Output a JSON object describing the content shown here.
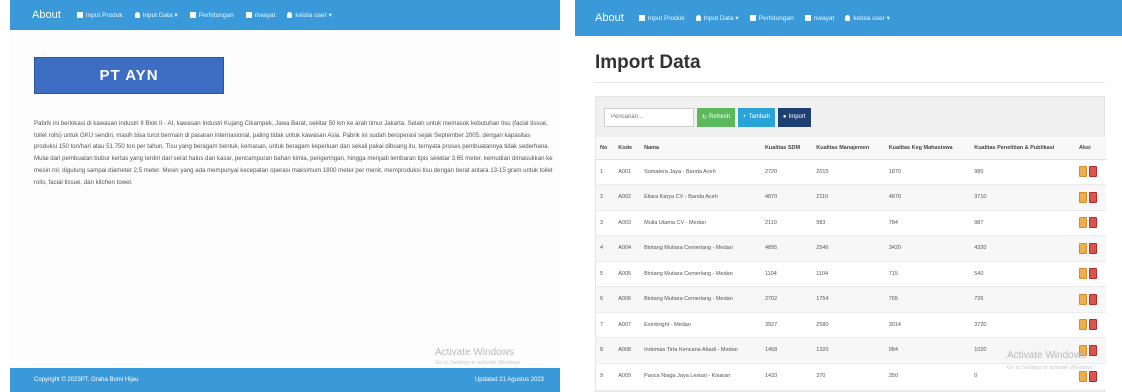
{
  "left": {
    "nav": {
      "brand": "About",
      "items": [
        {
          "label": "Input Produk",
          "icon": "list-icon"
        },
        {
          "label": "Input Data ▾",
          "icon": "user-icon"
        },
        {
          "label": "Perhitungan",
          "icon": "calculator-icon"
        },
        {
          "label": "riwayat",
          "icon": "list-icon"
        },
        {
          "label": "kelola user ▾",
          "icon": "user-icon"
        }
      ]
    },
    "company_name": "PT AYN",
    "description": "Pabrik ini berlokasi di kawasan industri II Blok II - AI, kawasan Industri Kujang Cikampek, Jawa Barat, sekitar 50 km ke arah timur Jakarta. Selain untuk memasok kebutuhan tisu (facial tissue, toilet rolls) untuk GKU sendiri, masih bisa turut bermain di pasaran internasional, paling tidak untuk kawasan Asia. Pabrik ini sudah beroperasi sejak September 2005, dengan kapasitas produksi 150 ton/hari atau 51.750 ton per tahun. Tisu yang beragam bentuk, kemasan, untuk beragam keperluan dan sekali pakai dibuang itu, ternyata proses pembuatannya tidak sederhana. Mulai dari pembuatan bubur kertas yang terdiri dari serat halus dan kasar, pencampuran bahan kimia, pengeringan, hingga menjadi lembaran tipis selebar 3,65 meter, kemudian dimasukkan ke mesin rol, digulung sampai diameter 2,5 meter. Mesin yang ada mempunyai kecepatan operasi maksimum 1800 meter per menit, memproduksi tisu dengan berat antara 13-15 gram untuk toilet rolls, facial tissue, dan kitchen towel.",
    "footer_left": "Copyright © 2023PT. Graha Bumi Hijau",
    "footer_right": "Updated 21 Agustus 2023",
    "watermark": "Activate Windows",
    "watermark_sub": "Go to Settings to activate Windows."
  },
  "right": {
    "nav": {
      "brand": "About",
      "items": [
        {
          "label": "Input Produk",
          "icon": "list-icon"
        },
        {
          "label": "Input Data ▾",
          "icon": "user-icon"
        },
        {
          "label": "Perhitungan",
          "icon": "calculator-icon"
        },
        {
          "label": "riwayat",
          "icon": "list-icon"
        },
        {
          "label": "kelola user ▾",
          "icon": "user-icon"
        }
      ]
    },
    "heading": "Import Data",
    "search_placeholder": "Pencarian...",
    "buttons": {
      "refresh": "Refresh",
      "add": "Tambah",
      "import": "Import"
    },
    "table": {
      "headers": [
        "No",
        "Kode",
        "Nama",
        "Kualitas SDM",
        "Kualitas Manajemen",
        "Kualitas Keg Mahasiswa",
        "Kualitas Penelitian & Publikasi",
        "Aksi"
      ],
      "rows": [
        [
          "1",
          "A001",
          "Sumatera Jaya - Banda Aceh",
          "2720",
          "2015",
          "1870",
          "980"
        ],
        [
          "2",
          "A002",
          "Eliara Karya CV - Banda Aceh",
          "4870",
          "2110",
          "4870",
          "3710"
        ],
        [
          "3",
          "A003",
          "Mulia Utama CV - Medan",
          "2110",
          "983",
          "784",
          "987"
        ],
        [
          "4",
          "A004",
          "Bintang Mutiara Cemerlang - Medan",
          "4895",
          "2546",
          "3420",
          "4320"
        ],
        [
          "5",
          "A005",
          "Bintang Mutiara Cemerlang - Medan",
          "1104",
          "1104",
          "715",
          "540"
        ],
        [
          "6",
          "A006",
          "Bintang Mutiara Cemerlang - Medan",
          "2702",
          "1754",
          "765",
          "726"
        ],
        [
          "7",
          "A007",
          "Everbright - Medan",
          "3927",
          "2580",
          "3014",
          "3720"
        ],
        [
          "8",
          "A008",
          "Indomas Tirta Kencana Abadi - Medan",
          "1458",
          "1320",
          "984",
          "1020"
        ],
        [
          "9",
          "A009",
          "Panca Niaga Jaya Lestari - Kisaran",
          "1433",
          "370",
          "350",
          "0"
        ]
      ]
    },
    "watermark": "Activate Windows",
    "watermark_sub": "Go to Settings to activate Windows."
  },
  "colors": {
    "navbar": "#3a9ad9",
    "brand_box": "#3d6ec3",
    "btn_refresh": "#5cb85c",
    "btn_add": "#2aa3d8",
    "btn_import": "#1f3f73",
    "edit": "#f0ad4e",
    "delete": "#d9534f"
  }
}
